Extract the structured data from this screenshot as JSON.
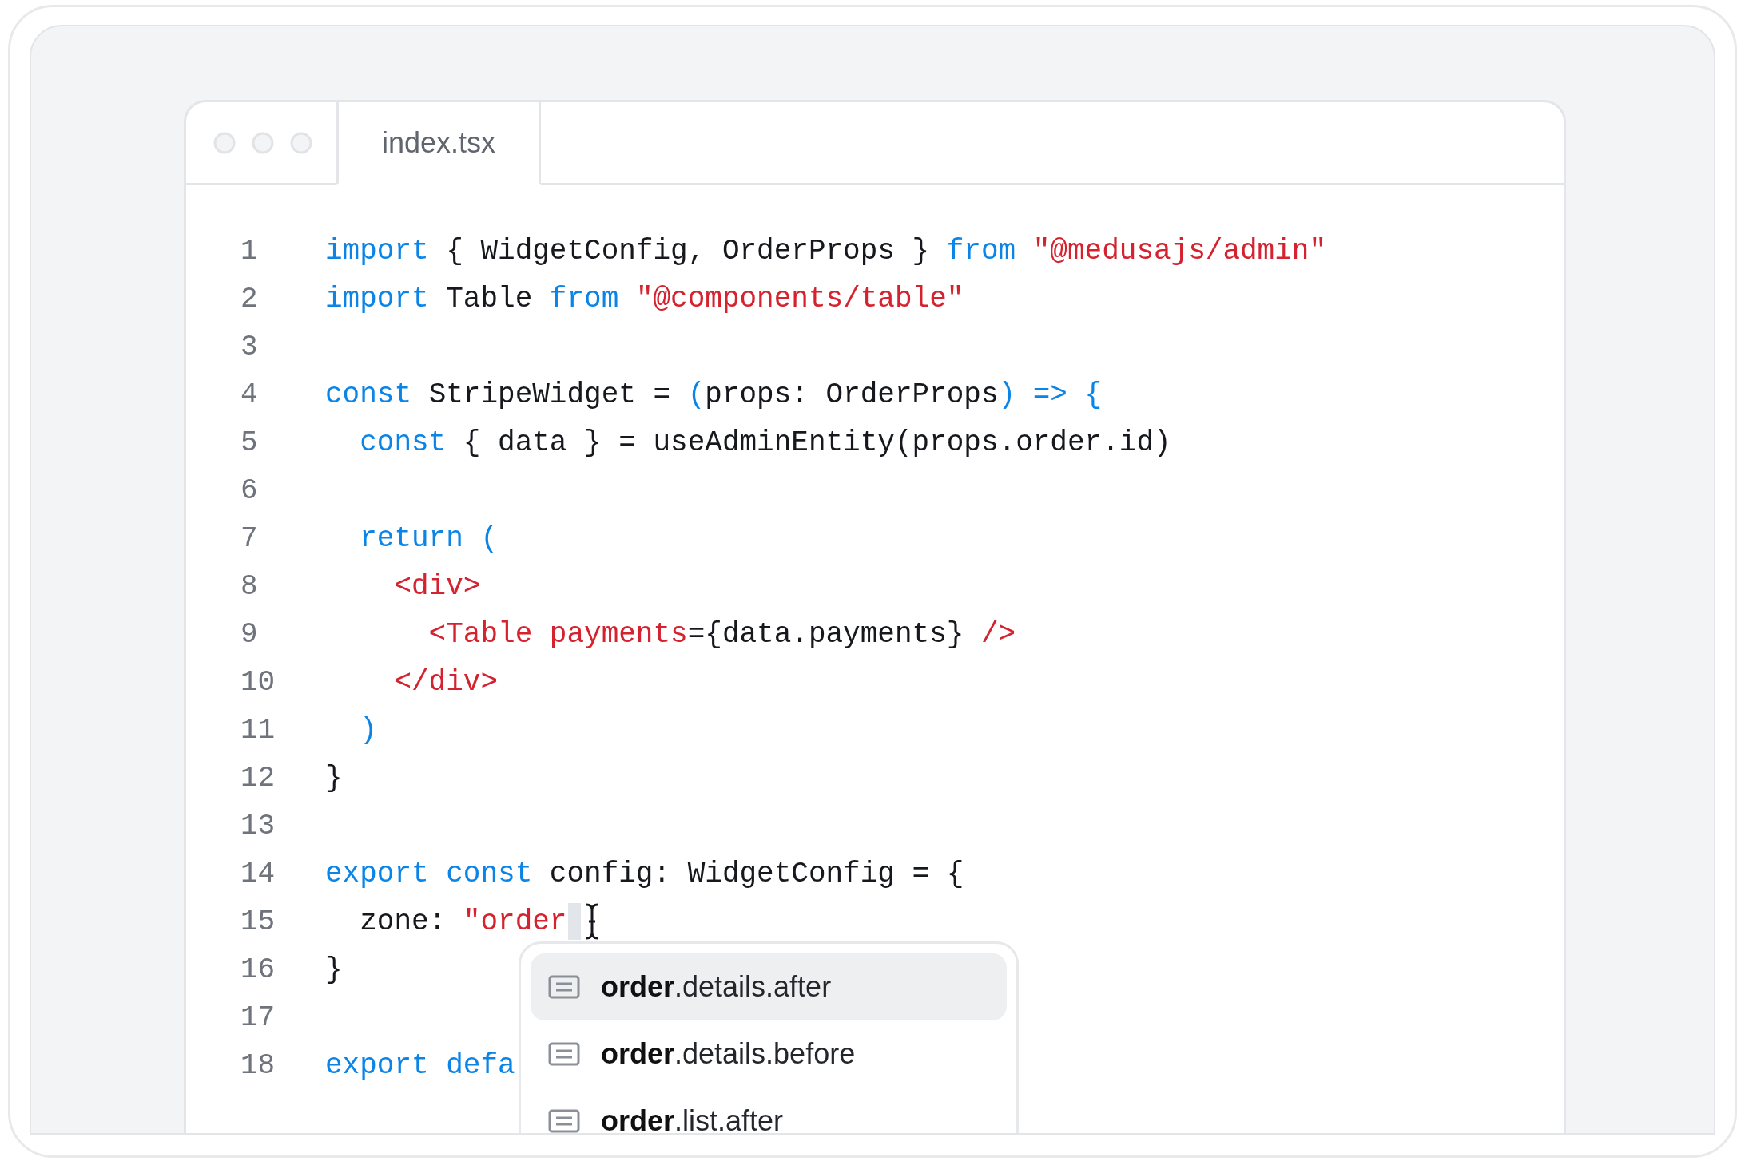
{
  "window": {
    "tab": {
      "label": "index.tsx",
      "selected": true
    }
  },
  "code": [
    {
      "number": "1",
      "tokens": [
        {
          "kind": "keyword",
          "text": "import"
        },
        {
          "kind": "plain",
          "text": " { WidgetConfig, OrderProps } "
        },
        {
          "kind": "keyword",
          "text": "from"
        },
        {
          "kind": "string",
          "text": " \"@medusajs/admin\""
        }
      ]
    },
    {
      "number": "2",
      "tokens": [
        {
          "kind": "keyword",
          "text": "import"
        },
        {
          "kind": "plain",
          "text": " Table "
        },
        {
          "kind": "keyword",
          "text": "from"
        },
        {
          "kind": "string",
          "text": " \"@components/table\""
        }
      ]
    },
    {
      "number": "3"
    },
    {
      "number": "4",
      "tokens": [
        {
          "kind": "keyword",
          "text": "const"
        },
        {
          "kind": "plain",
          "text": " StripeWidget = "
        },
        {
          "kind": "keyword",
          "text": "("
        },
        {
          "kind": "plain",
          "text": "props: OrderProps"
        },
        {
          "kind": "keyword",
          "text": ") => {"
        }
      ]
    },
    {
      "number": "5",
      "tokens": [
        {
          "kind": "keyword",
          "text": "  const"
        },
        {
          "kind": "plain",
          "text": " { data } = useAdminEntity(props.order.id)"
        }
      ]
    },
    {
      "number": "6"
    },
    {
      "number": "7",
      "tokens": [
        {
          "kind": "keyword",
          "text": "  return ("
        }
      ]
    },
    {
      "number": "8",
      "tokens": [
        {
          "kind": "string",
          "text": "    <div>"
        }
      ]
    },
    {
      "number": "9",
      "tokens": [
        {
          "kind": "string",
          "text": "      <Table payments"
        },
        {
          "kind": "plain",
          "text": "={data.payments} "
        },
        {
          "kind": "string",
          "text": "/>"
        }
      ]
    },
    {
      "number": "10",
      "tokens": [
        {
          "kind": "string",
          "text": "    </div>"
        }
      ]
    },
    {
      "number": "11",
      "tokens": [
        {
          "kind": "keyword",
          "text": "  )"
        }
      ]
    },
    {
      "number": "12",
      "tokens": [
        {
          "kind": "plain",
          "text": "}"
        }
      ]
    },
    {
      "number": "13"
    },
    {
      "number": "14",
      "tokens": [
        {
          "kind": "keyword",
          "text": "export const"
        },
        {
          "kind": "plain",
          "text": " config: WidgetConfig = {"
        }
      ]
    },
    {
      "number": "15",
      "cursor": true,
      "tokens": [
        {
          "kind": "plain",
          "text": "  zone: "
        },
        {
          "kind": "string",
          "text": "\"order"
        }
      ]
    },
    {
      "number": "16",
      "tokens": [
        {
          "kind": "plain",
          "text": "}"
        }
      ]
    },
    {
      "number": "17"
    },
    {
      "number": "18",
      "tokens": [
        {
          "kind": "keyword",
          "text": "export defa"
        }
      ]
    }
  ],
  "suggestions": [
    {
      "label": "**order**.details.after",
      "selected": true
    },
    {
      "label": "**order**.details.before",
      "selected": false
    },
    {
      "label": "**order**.list.after",
      "selected": false
    }
  ]
}
